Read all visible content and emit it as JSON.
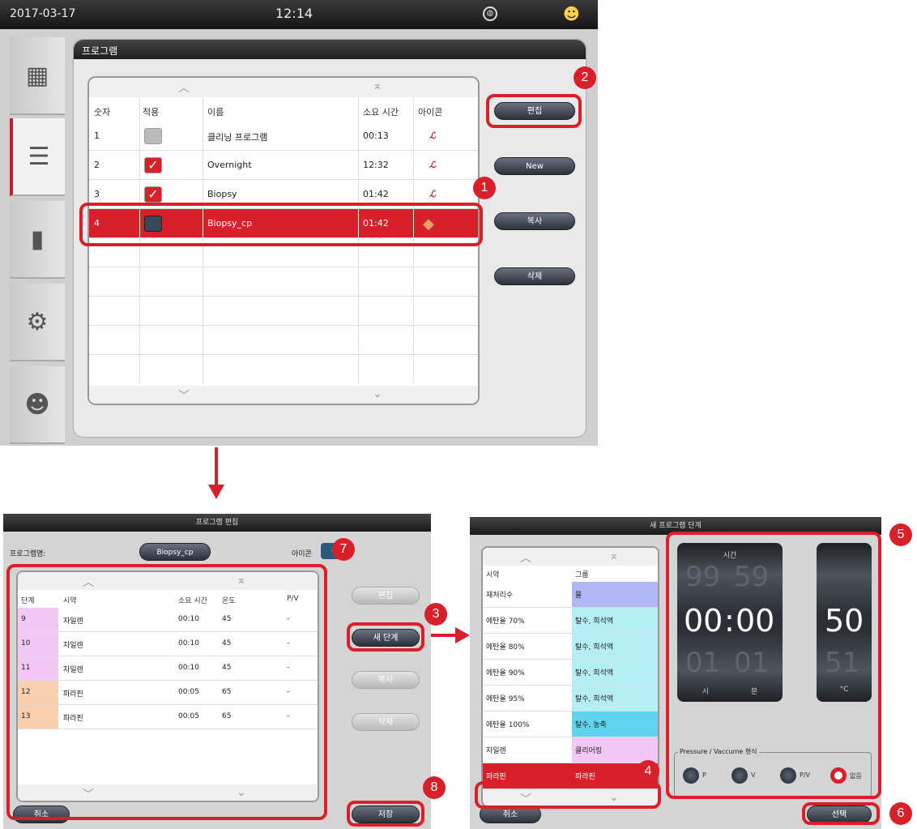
{
  "topbar": {
    "date": "2017-03-17",
    "time": "12:14",
    "globe_icon": "globe-icon",
    "user_icon": "user-icon"
  },
  "sidebar": {
    "items": [
      {
        "name": "reagent-station-icon",
        "glyph": "▦"
      },
      {
        "name": "program-list-icon",
        "glyph": "☰"
      },
      {
        "name": "reagent-bottle-icon",
        "glyph": "▮"
      },
      {
        "name": "gear-icon",
        "glyph": "⚙"
      },
      {
        "name": "user-icon",
        "glyph": "☻"
      }
    ]
  },
  "program_panel": {
    "title": "프로그램",
    "headers": [
      "숫자",
      "적용",
      "이름",
      "소요 시간",
      "아이콘"
    ],
    "rows": [
      {
        "num": "1",
        "name": "클리닝 프로그램",
        "time": "00:13",
        "icon": "ℒ"
      },
      {
        "num": "2",
        "name": "Overnight",
        "time": "12:32",
        "icon": "ℒ"
      },
      {
        "num": "3",
        "name": "Biopsy",
        "time": "01:42",
        "icon": "ℒ"
      },
      {
        "num": "4",
        "name": "Biopsy_cp",
        "time": "01:42",
        "icon": "◆"
      }
    ],
    "buttons": {
      "edit": "편집",
      "new": "New",
      "copy": "복사",
      "delete": "삭제"
    }
  },
  "badges": [
    "1",
    "2",
    "3",
    "4",
    "5",
    "6",
    "7",
    "8"
  ],
  "edit_screen": {
    "title": "프로그램 편집",
    "program_name_label": "프로그램명:",
    "program_name_value": "Biopsy_cp",
    "icon_label": "아이콘",
    "headers": [
      "단계",
      "시약",
      "소요 시간",
      "온도",
      "P/V"
    ],
    "rows": [
      {
        "step": "9",
        "reagent": "자일렌",
        "time": "00:10",
        "temp": "45",
        "pv": "-",
        "color": "#f4c8f4"
      },
      {
        "step": "10",
        "reagent": "자일렌",
        "time": "00:10",
        "temp": "45",
        "pv": "-",
        "color": "#f4c8f4"
      },
      {
        "step": "11",
        "reagent": "자일렌",
        "time": "00:10",
        "temp": "45",
        "pv": "-",
        "color": "#f4c8f4"
      },
      {
        "step": "12",
        "reagent": "파라핀",
        "time": "00:05",
        "temp": "65",
        "pv": "-",
        "color": "#f8cfae"
      },
      {
        "step": "13",
        "reagent": "파라핀",
        "time": "00:05",
        "temp": "65",
        "pv": "-",
        "color": "#f8cfae"
      }
    ],
    "buttons": {
      "edit": "편집",
      "new_step": "새 단계",
      "copy": "복사",
      "delete": "삭제",
      "cancel": "취소",
      "save": "저장"
    }
  },
  "new_step_screen": {
    "title": "새 프로그램 단계",
    "headers": [
      "시약",
      "그룹"
    ],
    "rows": [
      {
        "reagent": "재처리수",
        "group": "물",
        "color": "#b0b8f4"
      },
      {
        "reagent": "에탄올 70%",
        "group": "탈수, 희석액",
        "color": "#b6eef6"
      },
      {
        "reagent": "에탄올 80%",
        "group": "탈수, 희석액",
        "color": "#b6eef6"
      },
      {
        "reagent": "에탄올 90%",
        "group": "탈수, 희석액",
        "color": "#b6eef6"
      },
      {
        "reagent": "에탄올 95%",
        "group": "탈수, 희석액",
        "color": "#b6eef6"
      },
      {
        "reagent": "에탄올 100%",
        "group": "탈수, 농축",
        "color": "#5ed4ee"
      },
      {
        "reagent": "자일렌",
        "group": "클리어링",
        "color": "#f4c8f4"
      },
      {
        "reagent": "파라핀",
        "group": "파라핀",
        "color": "#d8202a"
      }
    ],
    "time_label": "시간",
    "hours_prev": "99",
    "mins_prev": "59",
    "hours": "00",
    "mins": "00",
    "hours_next": "01",
    "mins_next": "01",
    "hour_unit": "시",
    "min_unit": "분",
    "temp": "50",
    "temp_next": "51",
    "temp_unit": "°C",
    "pv_label": "Pressure / Vaccume 형식",
    "pv_options": [
      "P",
      "V",
      "P/V",
      "없음"
    ],
    "buttons": {
      "cancel": "취소",
      "select": "선택"
    }
  },
  "colors": {
    "accent": "#d8202a",
    "dark": "#1e1e1e"
  }
}
